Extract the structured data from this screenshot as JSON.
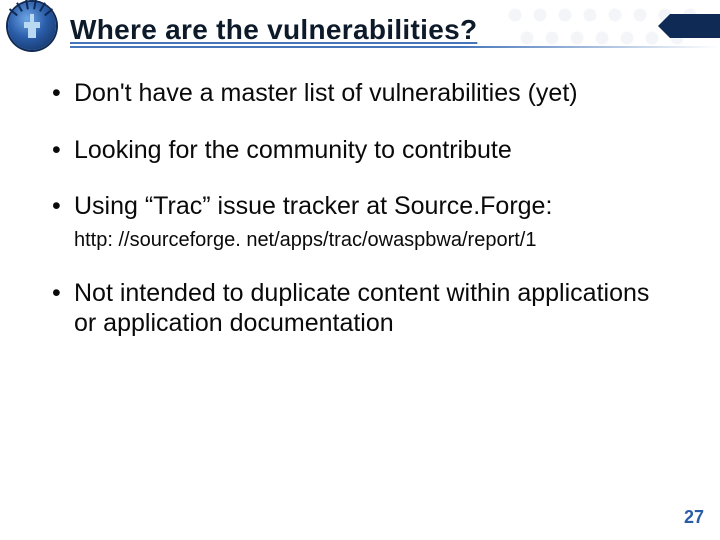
{
  "title": "Where are the vulnerabilities?",
  "bullets": [
    {
      "text": "Don't have a master list of vulnerabilities (yet)"
    },
    {
      "text": "Looking for the community to contribute"
    },
    {
      "text": "Using “Trac” issue tracker at Source.Forge:",
      "sub": "http: //sourceforge. net/apps/trac/owaspbwa/report/1"
    },
    {
      "text": "Not intended to duplicate content within applications or application documentation"
    }
  ],
  "page_number": "27",
  "logo_name": "owasp-liberty-logo"
}
